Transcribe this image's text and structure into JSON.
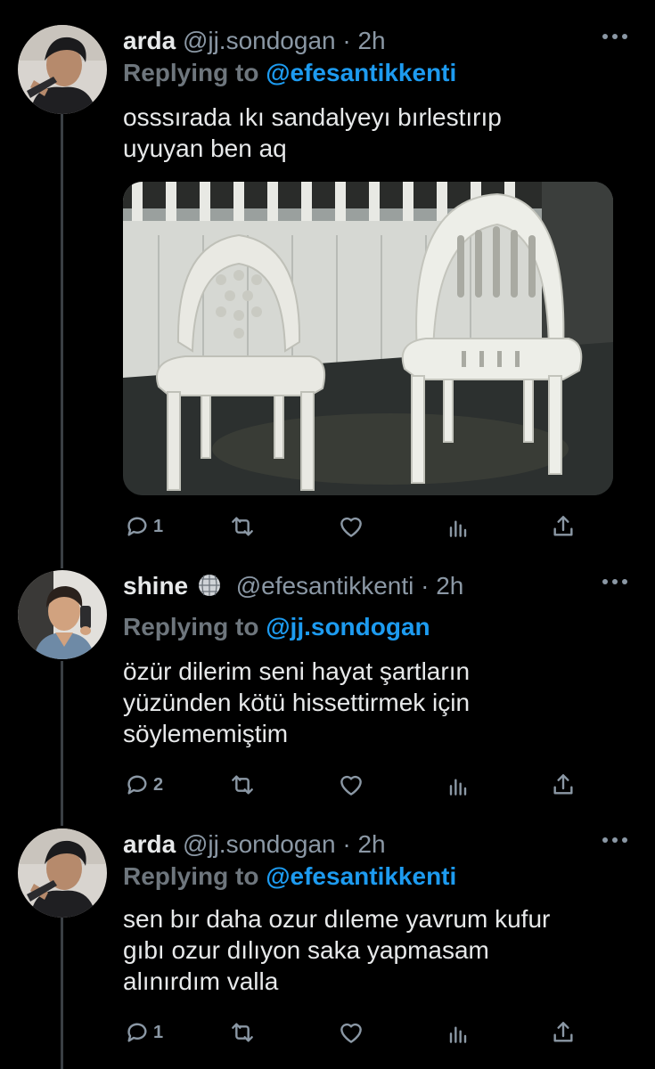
{
  "tweets": [
    {
      "name": "arda",
      "handle": "@jj.sondogan",
      "time": "2h",
      "sep": "·",
      "replying_prefix": "Replying to",
      "replying_to": "@efesantikkenti",
      "text_lines": [
        "osssırada ıkı sandalyeyı bırlestırıp",
        "uyuyan ben aq"
      ],
      "reply_count": "1",
      "media": "photo of two white plastic chairs"
    },
    {
      "name": "shine",
      "handle": "@efesantikkenti",
      "time": "2h",
      "sep": "·",
      "replying_prefix": "Replying to",
      "replying_to": "@jj.sondogan",
      "text_lines": [
        "özür dilerim seni hayat şartların",
        "yüzünden kötü hissettirmek için",
        "söylememiştim"
      ],
      "reply_count": "2"
    },
    {
      "name": "arda",
      "handle": "@jj.sondogan",
      "time": "2h",
      "sep": "·",
      "replying_prefix": "Replying to",
      "replying_to": "@efesantikkenti",
      "text_lines": [
        "sen bır daha ozur dıleme yavrum kufur",
        "gıbı ozur dılıyon saka yapmasam",
        "alınırdım valla"
      ],
      "reply_count": "1"
    }
  ],
  "colors": {
    "background": "#000000",
    "text": "#e7e9ea",
    "muted": "#8b98a5",
    "link": "#1d9bf0",
    "thread_line": "#3a3f44"
  },
  "icons": [
    "more-icon",
    "reply-icon",
    "retweet-icon",
    "like-icon",
    "analytics-icon",
    "share-icon",
    "disco-ball-icon"
  ]
}
